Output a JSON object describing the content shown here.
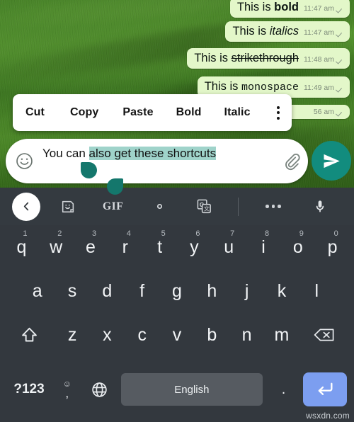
{
  "app": {
    "name": "WhatsApp chat with keyboard and text-selection menu"
  },
  "chat": {
    "messages": [
      {
        "prefix": "This is ",
        "styled": "bold",
        "style": "bold",
        "time": "11:47 am",
        "status": "sent-check"
      },
      {
        "prefix": "This is ",
        "styled": "italics",
        "style": "italic",
        "time": "11:47 am",
        "status": "sent-check"
      },
      {
        "prefix": "This is ",
        "styled": "strikethrough",
        "style": "strikethrough",
        "time": "11:48 am",
        "status": "sent-check"
      },
      {
        "prefix": "This is ",
        "styled": "monospace",
        "style": "monospace",
        "time": "11:49 am",
        "status": "sent-check"
      },
      {
        "prefix": "",
        "styled": "",
        "style": "hidden",
        "time": "56 am",
        "status": "sent-check"
      }
    ]
  },
  "context_menu": {
    "items": [
      "Cut",
      "Copy",
      "Paste",
      "Bold",
      "Italic"
    ],
    "overflow_label": "more-options"
  },
  "composer": {
    "emoji_icon": "emoji-smiley-icon",
    "text_before_selection": "You can ",
    "selected_text": "also get these shortcuts",
    "full_text": "You can also get these shortcuts",
    "attach_icon": "paperclip-icon",
    "send_icon": "send-paper-plane-icon",
    "selection_color": "#9fd3ca",
    "handle_color": "#14776c",
    "send_button_color": "#128c7e"
  },
  "keyboard": {
    "toolbar": [
      {
        "name": "back-button",
        "icon": "chevron-left-icon"
      },
      {
        "name": "sticker-button",
        "icon": "sticker-icon"
      },
      {
        "name": "gif-button",
        "icon": "gif-icon",
        "label": "GIF"
      },
      {
        "name": "settings-button",
        "icon": "gear-icon"
      },
      {
        "name": "translate-button",
        "icon": "translate-icon"
      },
      {
        "name": "divider",
        "icon": "divider"
      },
      {
        "name": "more-button",
        "icon": "overflow-dots-icon"
      },
      {
        "name": "voice-input-button",
        "icon": "microphone-icon"
      }
    ],
    "row1": [
      {
        "key": "q",
        "num": "1"
      },
      {
        "key": "w",
        "num": "2"
      },
      {
        "key": "e",
        "num": "3"
      },
      {
        "key": "r",
        "num": "4"
      },
      {
        "key": "t",
        "num": "5"
      },
      {
        "key": "y",
        "num": "6"
      },
      {
        "key": "u",
        "num": "7"
      },
      {
        "key": "i",
        "num": "8"
      },
      {
        "key": "o",
        "num": "9"
      },
      {
        "key": "p",
        "num": "0"
      }
    ],
    "row2": [
      "a",
      "s",
      "d",
      "f",
      "g",
      "h",
      "j",
      "k",
      "l"
    ],
    "row3": {
      "shift_icon": "shift-arrow-icon",
      "keys": [
        "z",
        "x",
        "c",
        "v",
        "b",
        "n",
        "m"
      ],
      "backspace_icon": "backspace-icon"
    },
    "row4": {
      "symbols_label": "?123",
      "comma_emoji": "☺",
      "comma_label": ",",
      "language_icon": "globe-icon",
      "space_label": "English",
      "period_label": ".",
      "enter_icon": "enter-return-icon",
      "enter_color": "#7c9ef0"
    }
  },
  "watermark": {
    "text": "wsxdn.com"
  }
}
